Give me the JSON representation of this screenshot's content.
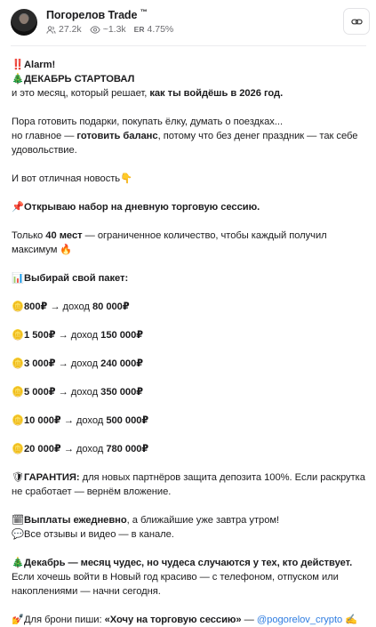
{
  "channel": {
    "name": "Погорелов Trade",
    "tm": "™",
    "subscribers": "27.2k",
    "views": "~1.3k",
    "er_label": "ER",
    "er_value": "4.75%"
  },
  "icons": {
    "alarm": "‼️",
    "tree": "🎄",
    "pointdown": "👇",
    "pin": "📌",
    "fire": "🔥",
    "chart": "📊",
    "coin": "🪙",
    "shield": "🛡",
    "calendar": "🗓",
    "speech": "💬",
    "lipstick": "💅",
    "writing": "✍️",
    "share": "link-icon"
  },
  "post": {
    "l1": "Alarm!",
    "l2": "ДЕКАБРЬ СТАРТОВАЛ",
    "l3a": "и это месяц, который решает, ",
    "l3b": "как ты войдёшь в 2026 год.",
    "l4": "Пора готовить подарки, покупать ёлку, думать о поездках...",
    "l5a": "но главное — ",
    "l5b": "готовить баланс",
    "l5c": ", потому что без денег праздник — так себе удовольствие.",
    "l6": "И вот отличная новость",
    "l7": "Открываю набор на дневную торговую сессию.",
    "l8a": "Только ",
    "l8b": "40 мест",
    "l8c": " — ограниченное количество, чтобы каждый получил максимум",
    "l9": "Выбирай свой пакет:",
    "packages": [
      {
        "amount": "800₽",
        "arrow": " → доход ",
        "income": "80 000₽"
      },
      {
        "amount": "1 500₽",
        "arrow": " → доход ",
        "income": "150 000₽"
      },
      {
        "amount": "3 000₽",
        "arrow": " → доход ",
        "income": "240 000₽"
      },
      {
        "amount": "5 000₽",
        "arrow": " → доход ",
        "income": "350 000₽"
      },
      {
        "amount": "10 000₽",
        "arrow": " → доход ",
        "income": "500 000₽"
      },
      {
        "amount": "20 000₽",
        "arrow": " → доход ",
        "income": "780 000₽"
      }
    ],
    "g1": "ГАРАНТИЯ:",
    "g2": " для новых партнёров защита депозита 100%. Если раскрутка не сработает — вернём вложение.",
    "p1": "Выплаты ежедневно",
    "p2": ", а ближайшие уже завтра утром!",
    "r1": "Все отзывы и видео — в канале.",
    "d1": "Декабрь — месяц чудес, но чудеса случаются у тех, кто действует.",
    "d2": "Если хочешь войти в Новый год красиво — с телефоном, отпуском или накоплениями — начни сегодня.",
    "c1": "Для брони пиши: ",
    "c2": "«Хочу на торговую сессию»",
    "c3": " — ",
    "c4": "@pogorelov_crypto"
  }
}
